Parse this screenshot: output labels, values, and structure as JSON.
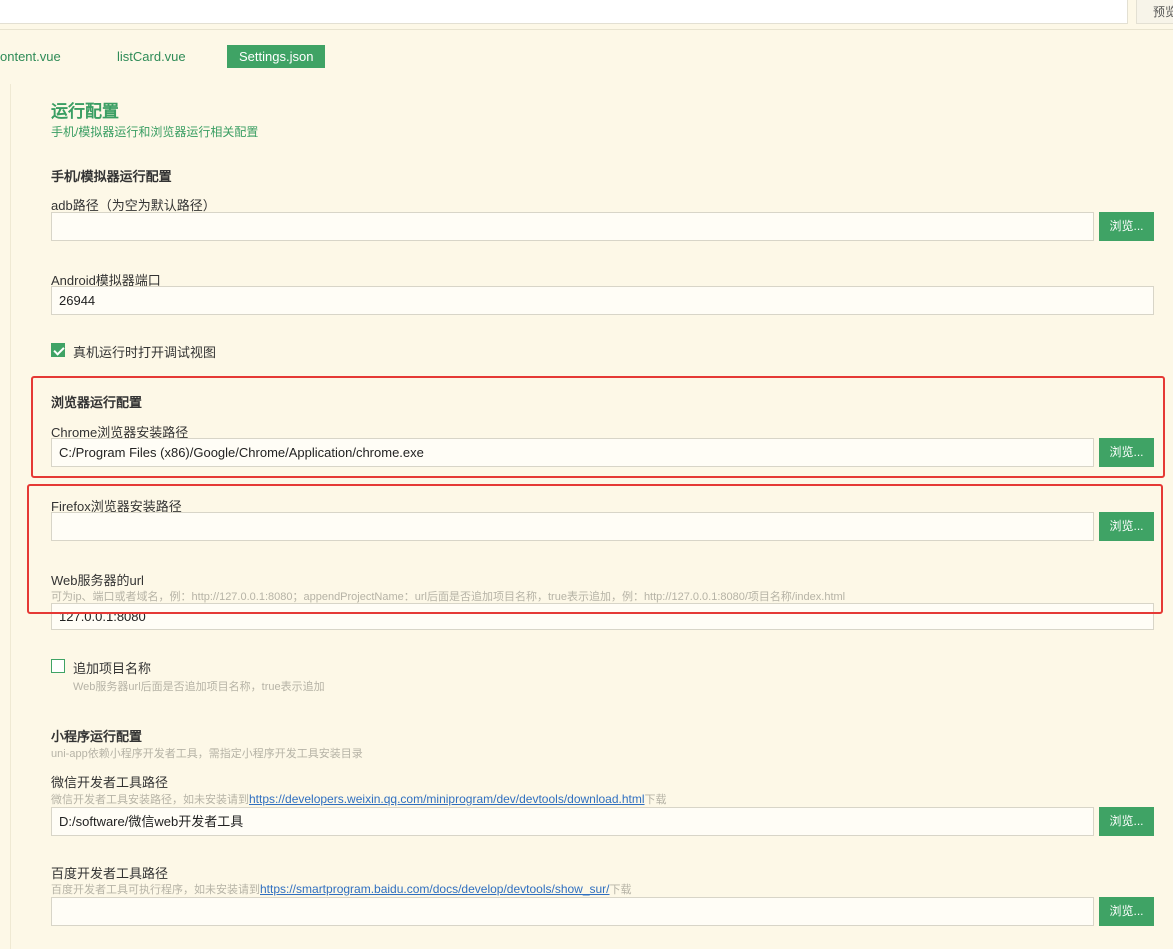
{
  "topbar": {
    "preview_label": "预览"
  },
  "tabs": [
    {
      "label": "ontent.vue"
    },
    {
      "label": "listCard.vue"
    },
    {
      "label": "Settings.json"
    }
  ],
  "section": {
    "title": "运行配置",
    "subtitle": "手机/模拟器运行和浏览器运行相关配置"
  },
  "mobile": {
    "title": "手机/模拟器运行配置",
    "adb_label": "adb路径（为空为默认路径）",
    "adb_value": "",
    "android_port_label": "Android模拟器端口",
    "android_port_value": "26944",
    "debug_view_label": "真机运行时打开调试视图"
  },
  "browser": {
    "title": "浏览器运行配置",
    "chrome_label": "Chrome浏览器安装路径",
    "chrome_value": "C:/Program Files (x86)/Google/Chrome/Application/chrome.exe",
    "firefox_label": "Firefox浏览器安装路径",
    "firefox_value": "",
    "web_url_label": "Web服务器的url",
    "web_url_hint": "可为ip、端口或者域名，例：http://127.0.0.1:8080；appendProjectName：url后面是否追加项目名称，true表示追加，例：http://127.0.0.1:8080/项目名称/index.html",
    "web_url_value": "127.0.0.1:8080",
    "append_label": "追加项目名称",
    "append_hint": "Web服务器url后面是否追加项目名称，true表示追加"
  },
  "miniprogram": {
    "title": "小程序运行配置",
    "hint": "uni-app依赖小程序开发者工具，需指定小程序开发工具安装目录",
    "wechat_label": "微信开发者工具路径",
    "wechat_hint_prefix": "微信开发者工具安装路径，如未安装请到",
    "wechat_link": "https://developers.weixin.qq.com/miniprogram/dev/devtools/download.html",
    "wechat_hint_suffix": "下载",
    "wechat_value": "D:/software/微信web开发者工具",
    "baidu_label": "百度开发者工具路径",
    "baidu_hint_prefix": "百度开发者工具可执行程序，如未安装请到",
    "baidu_link": "https://smartprogram.baidu.com/docs/develop/devtools/show_sur/",
    "baidu_hint_suffix": "下载",
    "baidu_value": ""
  },
  "buttons": {
    "browse_label": "浏览..."
  },
  "colors": {
    "accent": "#3fa365",
    "highlight": "#e53935",
    "background": "#fdf8e7"
  }
}
